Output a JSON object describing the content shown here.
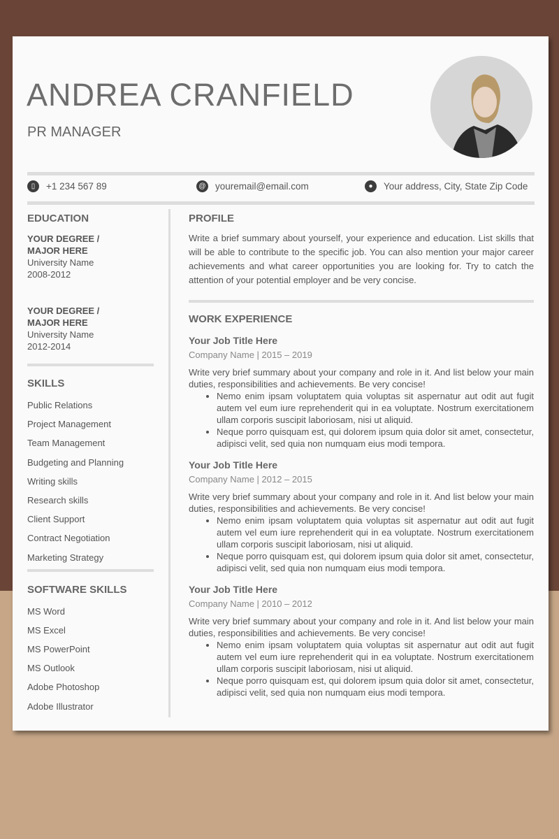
{
  "header": {
    "name": "ANDREA CRANFIELD",
    "role": "PR MANAGER"
  },
  "contact": {
    "phone": {
      "icon": "phone-icon",
      "text": "+1 234 567 89"
    },
    "email": {
      "icon": "at-icon",
      "text": "youremail@email.com"
    },
    "address": {
      "icon": "location-pin-icon",
      "text": "Your address, City, State Zip Code"
    }
  },
  "education": {
    "title": "EDUCATION",
    "items": [
      {
        "degree_line1": "YOUR DEGREE /",
        "degree_line2": "MAJOR HERE",
        "school": "University Name",
        "years": "2008-2012"
      },
      {
        "degree_line1": "YOUR DEGREE /",
        "degree_line2": "MAJOR HERE",
        "school": "University Name",
        "years": "2012-2014"
      }
    ]
  },
  "skills": {
    "title": "SKILLS",
    "items": [
      "Public Relations",
      "Project Management",
      "Team Management",
      "Budgeting and Planning",
      "Writing skills",
      "Research skills",
      "Client Support",
      "Contract Negotiation",
      "Marketing Strategy"
    ]
  },
  "software": {
    "title": "SOFTWARE SKILLS",
    "items": [
      "MS Word",
      "MS Excel",
      "MS PowerPoint",
      "MS Outlook",
      "Adobe Photoshop",
      "Adobe Illustrator"
    ]
  },
  "profile": {
    "title": "PROFILE",
    "text": "Write a brief summary about yourself, your experience and education. List skills that will be able to contribute to the specific job. You can also mention your major career achievements and what career opportunities you are looking for. Try to catch the attention of your potential employer and be very concise."
  },
  "work": {
    "title": "WORK EXPERIENCE",
    "jobs": [
      {
        "title": "Your Job Title Here",
        "company": "Company Name | 2015 – 2019",
        "summary": "Write very brief summary about your company and role in it. And list below your main duties, responsibilities and achievements. Be very concise!",
        "bullets": [
          "Nemo enim ipsam voluptatem quia voluptas sit aspernatur aut odit aut fugit autem vel eum iure reprehenderit qui in ea voluptate. Nostrum exercitationem ullam corporis suscipit laboriosam, nisi ut aliquid.",
          "Neque porro quisquam est, qui dolorem ipsum quia dolor sit amet, consectetur, adipisci velit, sed quia non numquam eius modi tempora."
        ]
      },
      {
        "title": "Your Job Title Here",
        "company": "Company Name | 2012 – 2015",
        "summary": "Write very brief summary about your company and role in it. And list below your main duties, responsibilities and achievements. Be very concise!",
        "bullets": [
          "Nemo enim ipsam voluptatem quia voluptas sit aspernatur aut odit aut fugit autem vel eum iure reprehenderit qui in ea voluptate. Nostrum exercitationem ullam corporis suscipit laboriosam, nisi ut aliquid.",
          "Neque porro quisquam est, qui dolorem ipsum quia dolor sit amet, consectetur, adipisci velit, sed quia non numquam eius modi tempora."
        ]
      },
      {
        "title": "Your Job Title Here",
        "company": "Company Name | 2010 – 2012",
        "summary": "Write very brief summary about your company and role in it. And list below your main duties, responsibilities and achievements. Be very concise!",
        "bullets": [
          "Nemo enim ipsam voluptatem quia voluptas sit aspernatur aut odit aut fugit autem vel eum iure reprehenderit qui in ea voluptate. Nostrum exercitationem ullam corporis suscipit laboriosam, nisi ut aliquid.",
          "Neque porro quisquam est, qui dolorem ipsum quia dolor sit amet, consectetur, adipisci velit, sed quia non numquam eius modi tempora."
        ]
      }
    ]
  }
}
